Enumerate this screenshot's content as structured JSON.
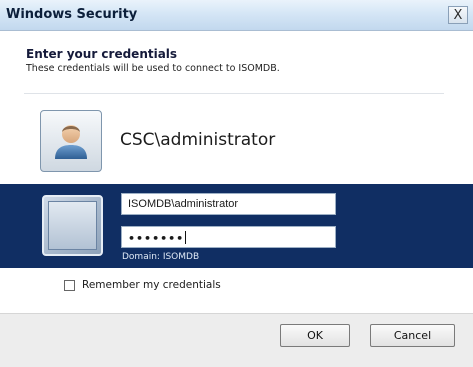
{
  "window": {
    "title": "Windows Security",
    "close_label": "X"
  },
  "header": {
    "title": "Enter your credentials",
    "description": "These credentials will be used to connect to ISOMDB."
  },
  "account": {
    "name": "CSC\\administrator",
    "icon": "user-icon"
  },
  "credentials": {
    "username": "ISOMDB\\administrator",
    "password_masked": "•••••••",
    "domain_text": "Domain: ISOMDB"
  },
  "remember": {
    "label": "Remember my credentials",
    "checked": false
  },
  "buttons": {
    "ok": "OK",
    "cancel": "Cancel"
  },
  "colors": {
    "selected_band": "#102e63",
    "titlebar": "#d5e6f6"
  }
}
